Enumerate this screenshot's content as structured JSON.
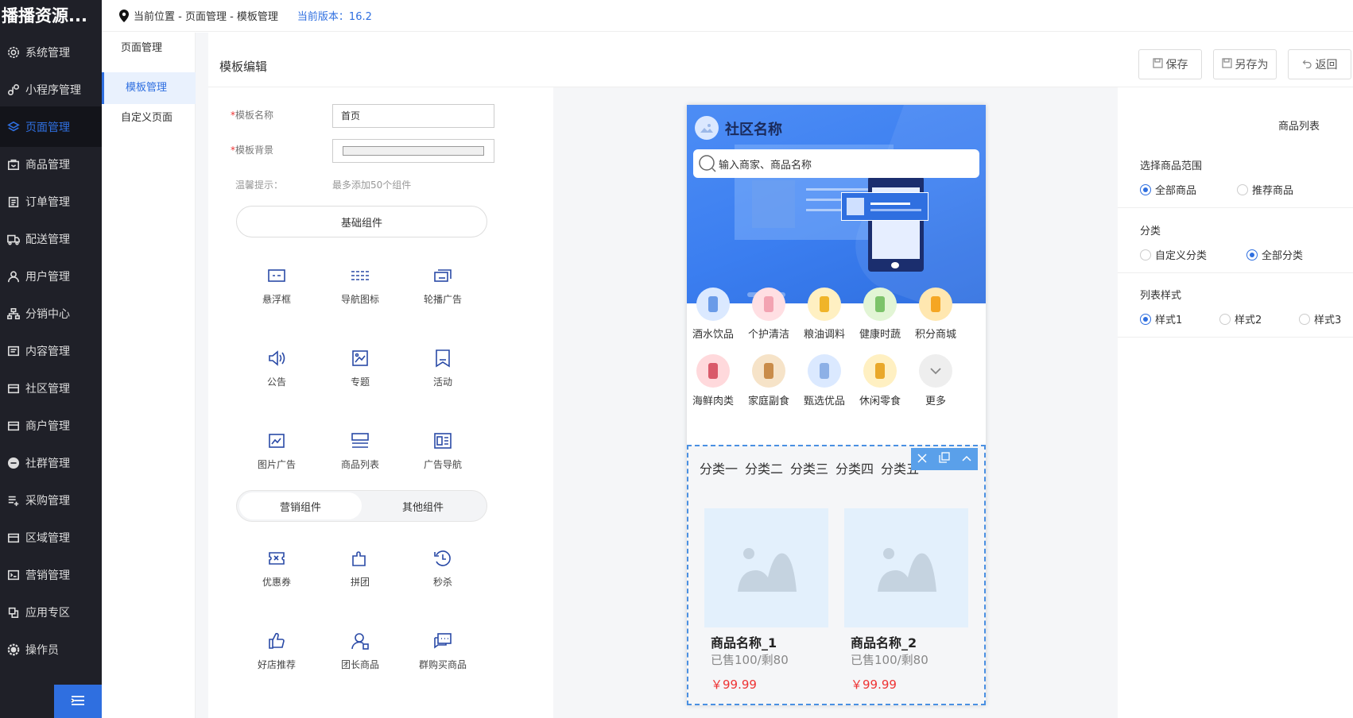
{
  "app": {
    "logo": "播播资源..."
  },
  "sidebar": {
    "items": [
      {
        "label": "系统管理",
        "icon": "gear-icon"
      },
      {
        "label": "小程序管理",
        "icon": "miniprogram-icon"
      },
      {
        "label": "页面管理",
        "icon": "layers-icon"
      },
      {
        "label": "商品管理",
        "icon": "bag-icon"
      },
      {
        "label": "订单管理",
        "icon": "clipboard-icon"
      },
      {
        "label": "配送管理",
        "icon": "truck-icon"
      },
      {
        "label": "用户管理",
        "icon": "user-icon"
      },
      {
        "label": "分销中心",
        "icon": "org-icon"
      },
      {
        "label": "内容管理",
        "icon": "content-icon"
      },
      {
        "label": "社区管理",
        "icon": "store-icon"
      },
      {
        "label": "商户管理",
        "icon": "shop-icon"
      },
      {
        "label": "社群管理",
        "icon": "minus-circle-icon"
      },
      {
        "label": "采购管理",
        "icon": "list-add-icon"
      },
      {
        "label": "区域管理",
        "icon": "region-icon"
      },
      {
        "label": "营销管理",
        "icon": "marketing-icon"
      },
      {
        "label": "应用专区",
        "icon": "app-icon"
      },
      {
        "label": "操作员",
        "icon": "settings-icon"
      }
    ]
  },
  "topbar": {
    "location": "当前位置 - 页面管理 - 模板管理",
    "version": "当前版本：16.2"
  },
  "subnav": {
    "items": [
      "页面管理",
      "模板管理",
      "自定义页面"
    ]
  },
  "editor": {
    "title": "模板编辑",
    "save": "保存",
    "save_as": "另存为",
    "back": "返回",
    "name_label": "模板名称",
    "name_value": "首页",
    "bg_label": "模板背景",
    "tip_label": "温馨提示：",
    "tip_text": "最多添加50个组件",
    "basic_group": "基础组件",
    "basic": [
      "悬浮框",
      "导航图标",
      "轮播广告",
      "公告",
      "专题",
      "活动",
      "图片广告",
      "商品列表",
      "广告导航"
    ],
    "tab_marketing": "营销组件",
    "tab_other": "其他组件",
    "marketing": [
      "优惠券",
      "拼团",
      "秒杀",
      "好店推荐",
      "团长商品",
      "群购买商品"
    ]
  },
  "preview": {
    "community": "社区名称",
    "search_placeholder": "输入商家、商品名称",
    "categories": [
      "酒水饮品",
      "个护清洁",
      "粮油调料",
      "健康时蔬",
      "积分商城",
      "海鲜肉类",
      "家庭副食",
      "甄选优品",
      "休闲零食",
      "更多"
    ],
    "tabs": [
      "分类一",
      "分类二",
      "分类三",
      "分类四",
      "分类五"
    ],
    "products": [
      {
        "name": "商品名称_1",
        "sold": "已售100/剩80",
        "price": "￥99.99"
      },
      {
        "name": "商品名称_2",
        "sold": "已售100/剩80",
        "price": "￥99.99"
      }
    ]
  },
  "panel": {
    "title": "商品列表",
    "range_label": "选择商品范围",
    "range_all": "全部商品",
    "range_rec": "推荐商品",
    "cat_label": "分类",
    "cat_custom": "自定义分类",
    "cat_all": "全部分类",
    "style_label": "列表样式",
    "style1": "样式1",
    "style2": "样式2",
    "style3": "样式3"
  },
  "colors": {
    "accent": "#2f6fe0",
    "sidebar": "#1f2028",
    "price": "#e33333"
  }
}
